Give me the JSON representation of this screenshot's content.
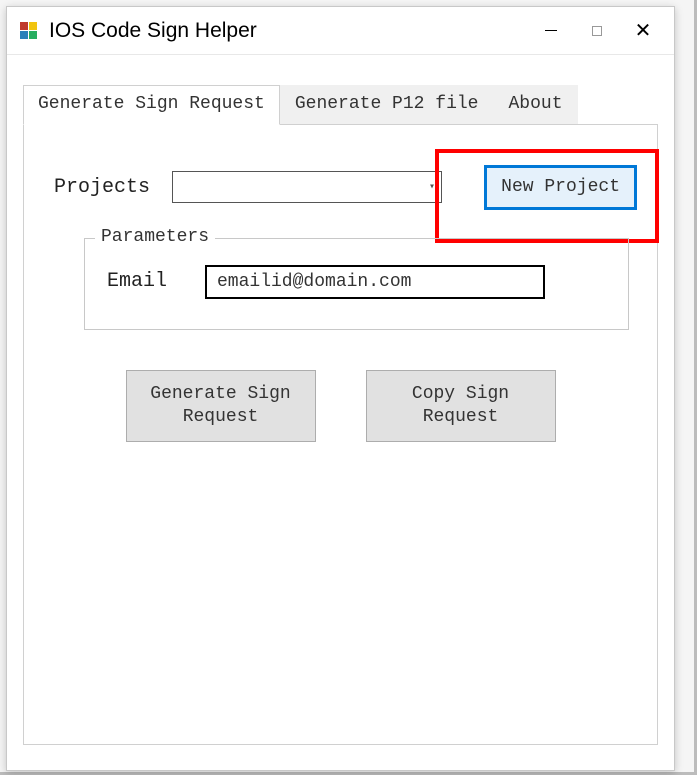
{
  "window": {
    "title": "IOS Code Sign Helper"
  },
  "tabs": [
    {
      "label": "Generate Sign Request",
      "active": true
    },
    {
      "label": "Generate P12 file",
      "active": false
    },
    {
      "label": "About",
      "active": false
    }
  ],
  "projects": {
    "label": "Projects",
    "selected": "",
    "new_button": "New Project"
  },
  "parameters": {
    "legend": "Parameters",
    "email_label": "Email",
    "email_value": "emailid@domain.com"
  },
  "buttons": {
    "generate": "Generate Sign\nRequest",
    "copy": "Copy Sign\nRequest"
  }
}
